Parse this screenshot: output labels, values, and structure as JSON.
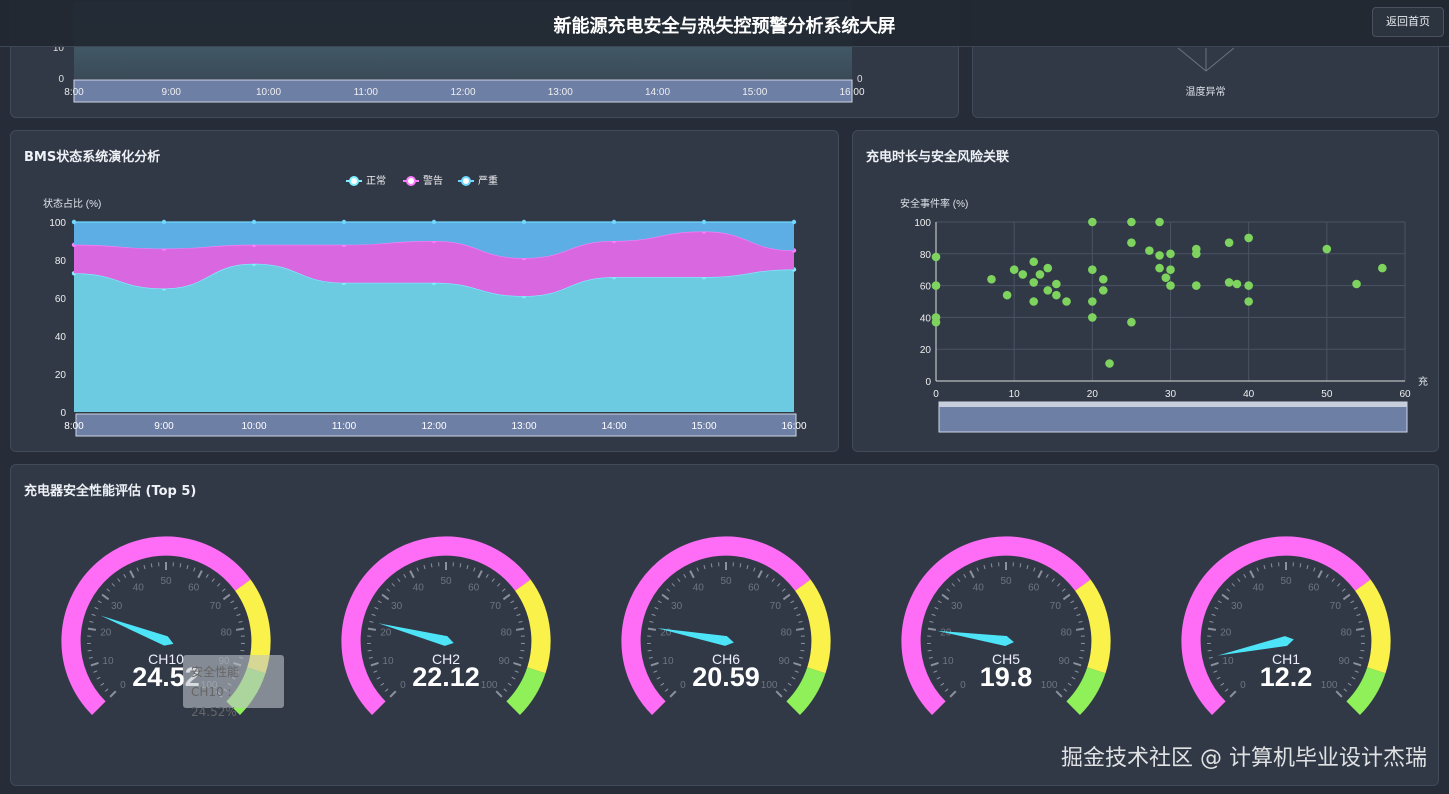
{
  "header": {
    "title": "新能源充电安全与热失控预警分析系统大屏",
    "back_label": "返回首页"
  },
  "top_left": {
    "y_labels": [
      "10",
      "0"
    ],
    "y_right_label": "0",
    "x_labels": [
      "8:00",
      "9:00",
      "10:00",
      "11:00",
      "12:00",
      "13:00",
      "14:00",
      "15:00",
      "16:00"
    ]
  },
  "top_right": {
    "radar_label": "温度异常"
  },
  "bms": {
    "title": "BMS状态系统演化分析",
    "y_axis_name": "状态占比 (%)",
    "chart_data": {
      "type": "area",
      "stacked": true,
      "categories": [
        "8:00",
        "9:00",
        "10:00",
        "11:00",
        "12:00",
        "13:00",
        "14:00",
        "15:00",
        "16:00"
      ],
      "series": [
        {
          "name": "正常",
          "color": "#6ccbe0",
          "line": "#7ff0ff",
          "values": [
            73,
            65,
            78,
            68,
            68,
            61,
            71,
            71,
            75
          ]
        },
        {
          "name": "警告",
          "color": "#d967e0",
          "line": "#ff7cff",
          "values": [
            15,
            21,
            10,
            20,
            22,
            20,
            19,
            24,
            10
          ]
        },
        {
          "name": "严重",
          "color": "#5eaee6",
          "line": "#6fd8ff",
          "values": [
            12,
            14,
            12,
            12,
            10,
            19,
            10,
            5,
            15
          ]
        }
      ],
      "ylim": [
        0,
        100
      ],
      "y_ticks": [
        "0",
        "20",
        "40",
        "60",
        "80",
        "100"
      ],
      "legend": "top-center"
    }
  },
  "scatter": {
    "title": "充电时长与安全风险关联",
    "y_axis_name": "安全事件率 (%)",
    "x_axis_name": "充",
    "chart_data": {
      "type": "scatter",
      "xlim": [
        0,
        60
      ],
      "ylim": [
        0,
        100
      ],
      "x_ticks": [
        "0",
        "10",
        "20",
        "30",
        "40",
        "50",
        "60"
      ],
      "y_ticks": [
        "0",
        "20",
        "40",
        "60",
        "80",
        "100"
      ],
      "color": "#7ed35e",
      "points": [
        [
          20,
          100
        ],
        [
          25,
          100
        ],
        [
          28.6,
          100
        ],
        [
          25,
          87
        ],
        [
          37.5,
          87
        ],
        [
          40,
          90
        ],
        [
          50,
          83
        ],
        [
          33.3,
          83
        ],
        [
          33.3,
          80
        ],
        [
          27.3,
          82
        ],
        [
          28.6,
          79
        ],
        [
          30,
          80
        ],
        [
          0,
          78
        ],
        [
          12.5,
          75
        ],
        [
          10,
          70
        ],
        [
          11.1,
          67
        ],
        [
          14.3,
          71
        ],
        [
          13.3,
          67
        ],
        [
          7.1,
          64
        ],
        [
          12.5,
          62
        ],
        [
          15.4,
          61
        ],
        [
          0,
          60
        ],
        [
          9.1,
          54
        ],
        [
          14.3,
          57
        ],
        [
          15.4,
          54
        ],
        [
          12.5,
          50
        ],
        [
          16.7,
          50
        ],
        [
          20,
          70
        ],
        [
          21.4,
          64
        ],
        [
          21.4,
          57
        ],
        [
          20,
          50
        ],
        [
          20,
          40
        ],
        [
          25,
          37
        ],
        [
          22.2,
          11
        ],
        [
          28.6,
          71
        ],
        [
          29.4,
          65
        ],
        [
          30,
          70
        ],
        [
          30,
          60
        ],
        [
          33.3,
          60
        ],
        [
          37.5,
          62
        ],
        [
          38.5,
          61
        ],
        [
          40,
          60
        ],
        [
          40,
          50
        ],
        [
          53.8,
          61
        ],
        [
          57.1,
          71
        ],
        [
          0,
          40
        ],
        [
          0,
          37
        ]
      ]
    }
  },
  "gauges": {
    "title": "充电器安全性能评估 (Top 5)",
    "colors": {
      "low": "#ff6cf5",
      "mid": "#faf24a",
      "high": "#8ff05a",
      "needle": "#4ee4f8"
    },
    "bands": [
      0.7,
      0.9
    ],
    "tick_labels": [
      "0",
      "10",
      "20",
      "30",
      "40",
      "50",
      "60",
      "70",
      "80",
      "90",
      "100"
    ],
    "items": [
      {
        "name": "CH10",
        "value": "24.52",
        "v": 24.52
      },
      {
        "name": "CH2",
        "value": "22.12",
        "v": 22.12
      },
      {
        "name": "CH6",
        "value": "20.59",
        "v": 20.59
      },
      {
        "name": "CH5",
        "value": "19.8",
        "v": 19.8
      },
      {
        "name": "CH1",
        "value": "12.2",
        "v": 12.2
      }
    ],
    "tooltip": {
      "title": "安全性能",
      "text": "CH10 : 24.52%"
    }
  },
  "watermark": "掘金技术社区 @ 计算机毕业设计杰瑞"
}
